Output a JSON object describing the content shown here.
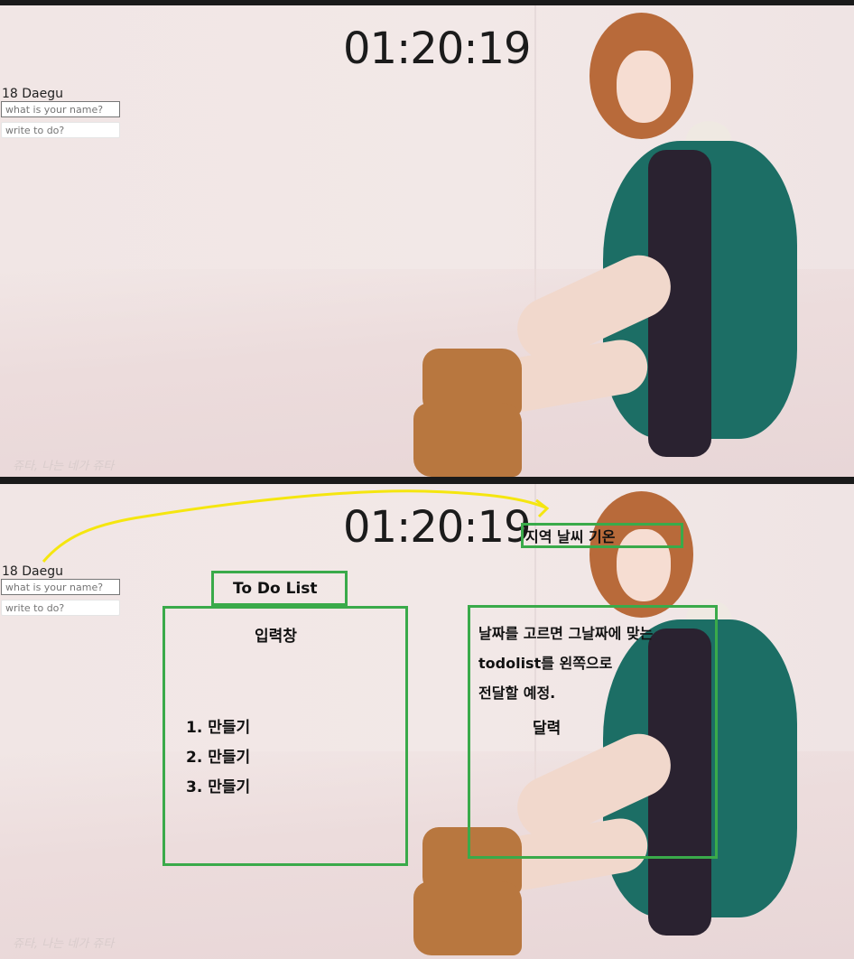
{
  "top": {
    "clock": "01:20:19",
    "weather": "18 Daegu",
    "name_placeholder": "what is your name?",
    "todo_placeholder": "write to do?",
    "watermark": "쥬타, 나는 네가 쥬타"
  },
  "bottom": {
    "clock": "01:20:19",
    "weather": "18 Daegu",
    "name_placeholder": "what is your name?",
    "todo_placeholder": "write to do?",
    "watermark": "쥬타, 나는 네가 쥬타",
    "annotations": {
      "weather_box": "지역 날씨 기온",
      "todo_title": "To Do List",
      "input_label": "입력창",
      "todo_items": [
        "1. 만들기",
        "2. 만들기",
        "3. 만들기"
      ],
      "calendar_note_line1": "날짜를 고르면 그날짜에 맞는",
      "calendar_note_line2": "todolist를 왼쪽으로",
      "calendar_note_line3": "전달할 예정.",
      "calendar_label": "달력"
    },
    "colors": {
      "annotation_box": "#3aaa4a",
      "arrow": "#f5e60f"
    }
  }
}
